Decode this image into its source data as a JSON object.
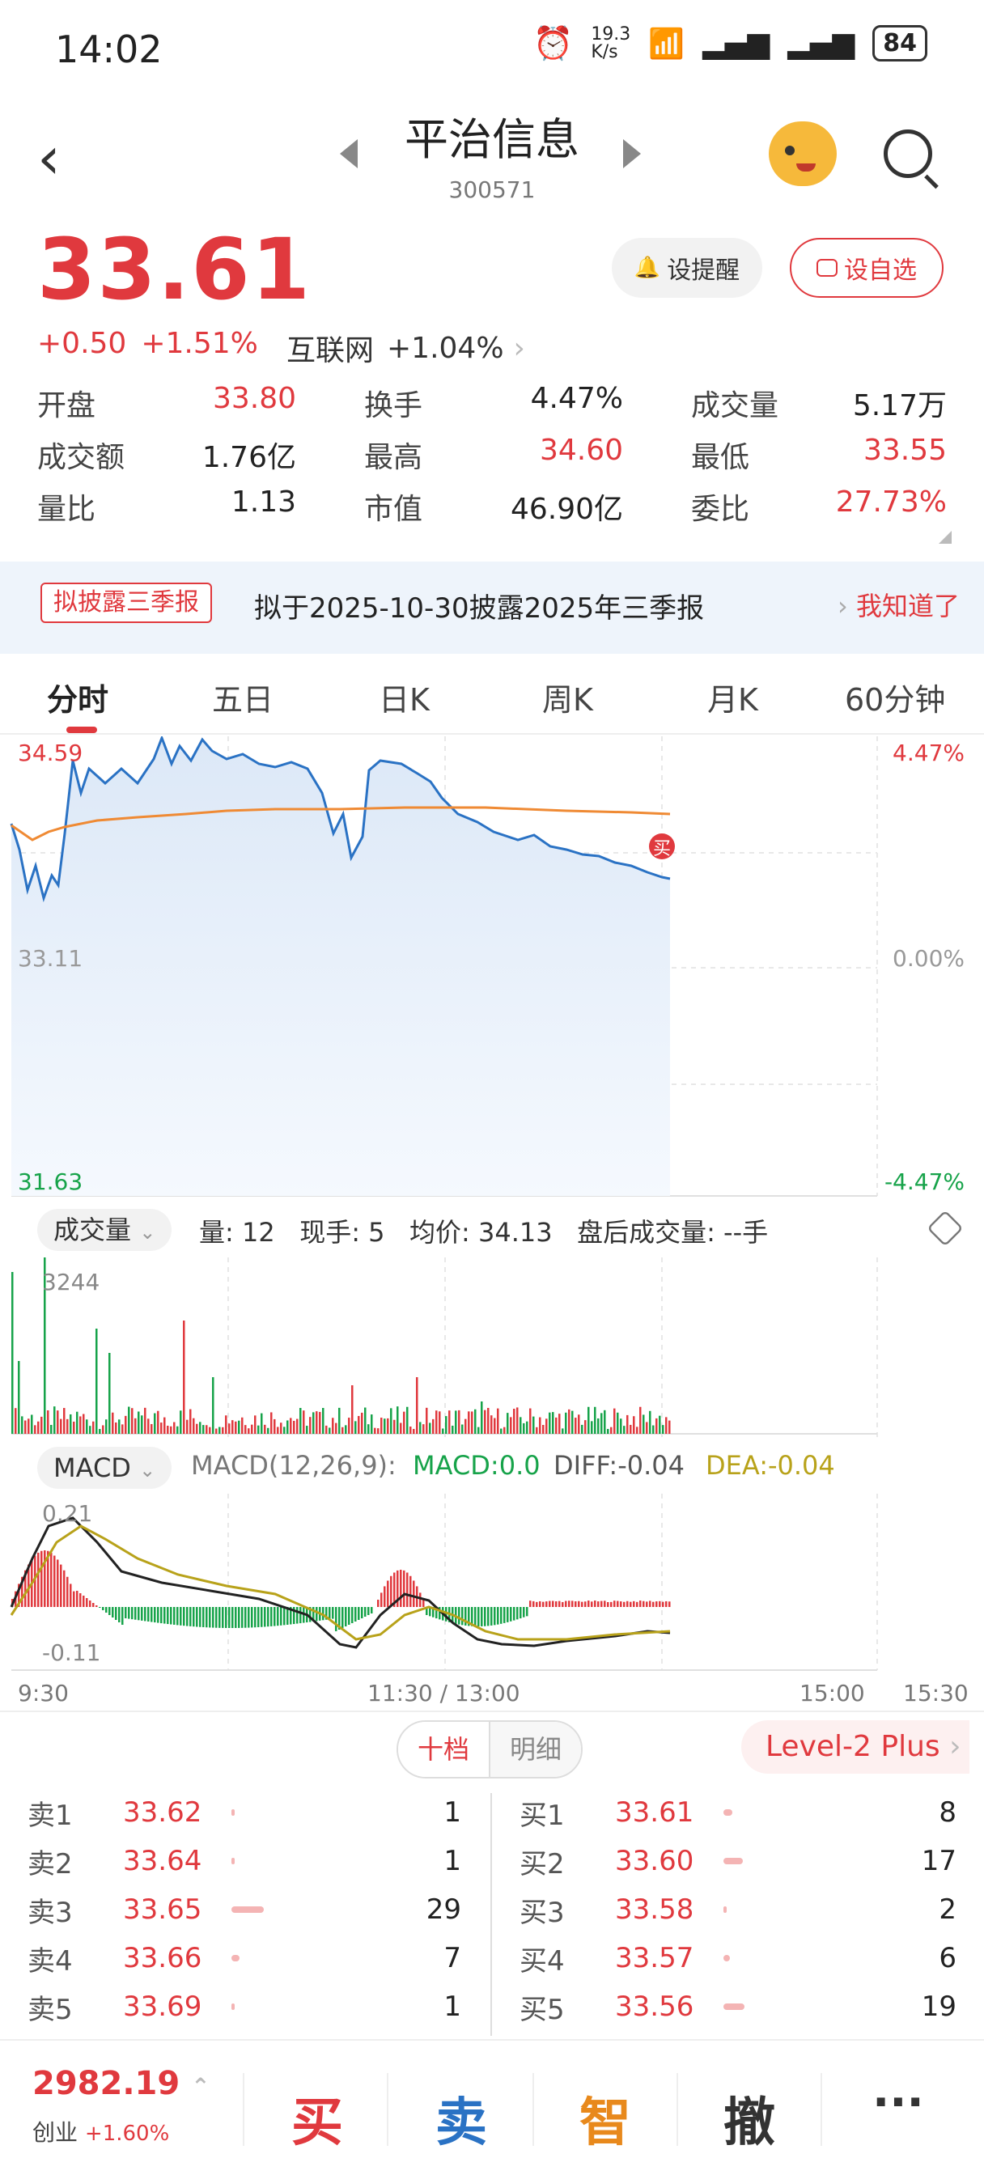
{
  "status": {
    "time": "14:02",
    "net_speed": "19.3\nK/s",
    "battery": "84"
  },
  "header": {
    "name": "平治信息",
    "code": "300571"
  },
  "quote": {
    "price": "33.61",
    "change": "+0.50",
    "change_pct": "+1.51%",
    "sector": "互联网",
    "sector_pct": "+1.04%",
    "alert_label": "设提醒",
    "fav_label": "设自选"
  },
  "stats": [
    [
      {
        "k": "开盘",
        "v": "33.80",
        "c": "red"
      },
      {
        "k": "换手",
        "v": "4.47%",
        "c": "dark"
      },
      {
        "k": "成交量",
        "v": "5.17万",
        "c": "dark"
      }
    ],
    [
      {
        "k": "成交额",
        "v": "1.76亿",
        "c": "dark"
      },
      {
        "k": "最高",
        "v": "34.60",
        "c": "red"
      },
      {
        "k": "最低",
        "v": "33.55",
        "c": "red"
      }
    ],
    [
      {
        "k": "量比",
        "v": "1.13",
        "c": "dark"
      },
      {
        "k": "市值",
        "v": "46.90亿",
        "c": "dark"
      },
      {
        "k": "委比",
        "v": "27.73%",
        "c": "red"
      }
    ]
  ],
  "notice": {
    "tag": "拟披露三季报",
    "text": "拟于2025-10-30披露2025年三季报",
    "action": "我知道了"
  },
  "tabs": [
    "分时",
    "五日",
    "日K",
    "周K",
    "月K",
    "60分钟"
  ],
  "intraday": {
    "y_high": "34.59",
    "y_mid": "33.11",
    "y_low": "31.63",
    "pct_high": "4.47%",
    "pct_mid": "0.00%",
    "pct_low": "-4.47%",
    "buy_marker": "买"
  },
  "volume": {
    "pill": "成交量",
    "info": "量: 12   现手: 5   均价: 34.13   盘后成交量: --手",
    "max_label": "3244"
  },
  "macd": {
    "pill": "MACD",
    "params": "MACD(12,26,9):",
    "macd": "MACD:0.0",
    "diff": "DIFF:-0.04",
    "dea": "DEA:-0.04",
    "top_label": "0.21",
    "bottom_label": "-0.11"
  },
  "time_axis": {
    "start": "9:30",
    "mid": "11:30 / 13:00",
    "t3": "15:00",
    "end": "15:30"
  },
  "orderbook": {
    "tab_active": "十档",
    "tab_other": "明细",
    "level2": "Level-2 Plus",
    "sell": [
      {
        "label": "卖1",
        "price": "33.62",
        "qty": "1",
        "bar": 0.02
      },
      {
        "label": "卖2",
        "price": "33.64",
        "qty": "1",
        "bar": 0.02
      },
      {
        "label": "卖3",
        "price": "33.65",
        "qty": "29",
        "bar": 0.5
      },
      {
        "label": "卖4",
        "price": "33.66",
        "qty": "7",
        "bar": 0.12
      },
      {
        "label": "卖5",
        "price": "33.69",
        "qty": "1",
        "bar": 0.02
      }
    ],
    "buy": [
      {
        "label": "买1",
        "price": "33.61",
        "qty": "8",
        "bar": 0.14
      },
      {
        "label": "买2",
        "price": "33.60",
        "qty": "17",
        "bar": 0.3
      },
      {
        "label": "买3",
        "price": "33.58",
        "qty": "2",
        "bar": 0.04
      },
      {
        "label": "买4",
        "price": "33.57",
        "qty": "6",
        "bar": 0.1
      },
      {
        "label": "买5",
        "price": "33.56",
        "qty": "19",
        "bar": 0.33
      }
    ]
  },
  "bottom": {
    "index_value": "2982.19",
    "index_name": "创业",
    "index_pct": "+1.60%",
    "buy": "买",
    "sell": "卖",
    "smart": "智",
    "cancel": "撤",
    "more": "···"
  },
  "colors": {
    "up": "#e0393e",
    "down": "#17a34a",
    "price_line": "#2a72c4",
    "avg_line": "#ef8a34",
    "dea": "#b8a21a"
  }
}
